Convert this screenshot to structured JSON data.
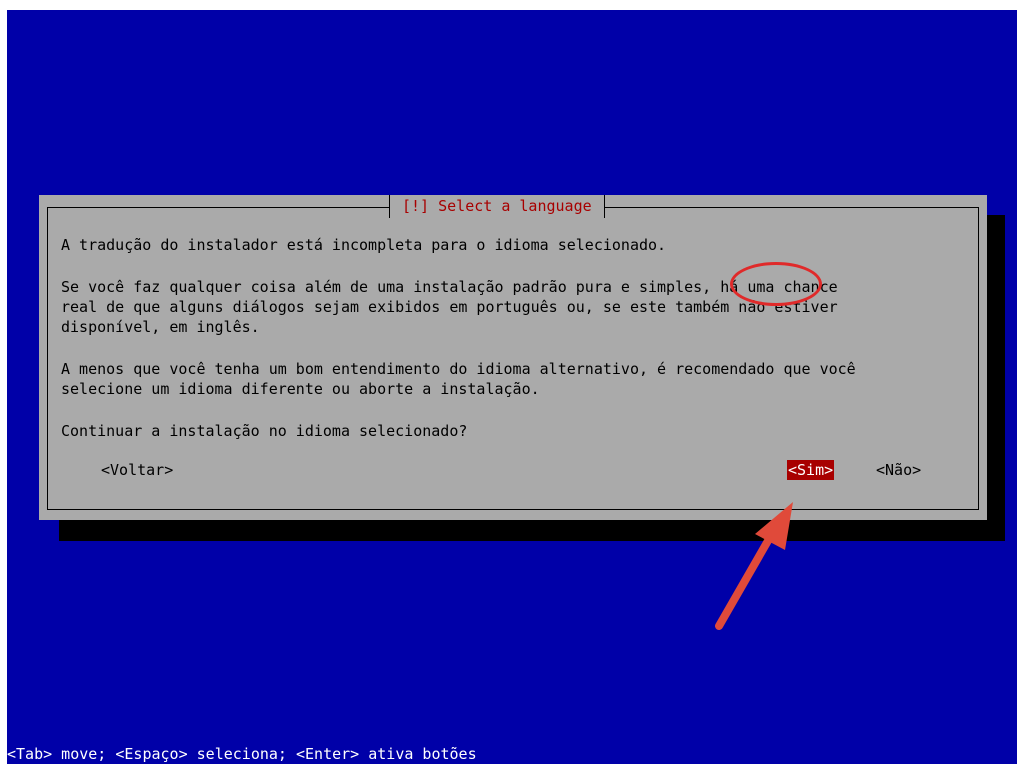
{
  "dialog": {
    "title": "[!] Select a language",
    "lines": [
      "A tradução do instalador está incompleta para o idioma selecionado.",
      "Se você faz qualquer coisa além de uma instalação padrão pura e simples, há uma chance",
      "real de que alguns diálogos sejam exibidos em português ou, se este também não estiver",
      "disponível, em inglês.",
      "A menos que você tenha um bom entendimento do idioma alternativo, é recomendado que você",
      "selecione um idioma diferente ou aborte a instalação.",
      "Continuar a instalação no idioma selecionado?"
    ],
    "buttons": {
      "back": "<Voltar>",
      "yes": "<Sim>",
      "no": "<Não>"
    }
  },
  "status_bar": "<Tab> move; <Espaço> seleciona; <Enter> ativa botões",
  "colors": {
    "background": "#0000a8",
    "dialog": "#aaaaaa",
    "title_text": "#a80000",
    "focused_button": "#a80000",
    "annotation": "#e02a2a"
  },
  "annotation": {
    "shape": "red-ellipse-around-sim-button",
    "arrow": "red-arrow-pointing-to-sim-button"
  }
}
